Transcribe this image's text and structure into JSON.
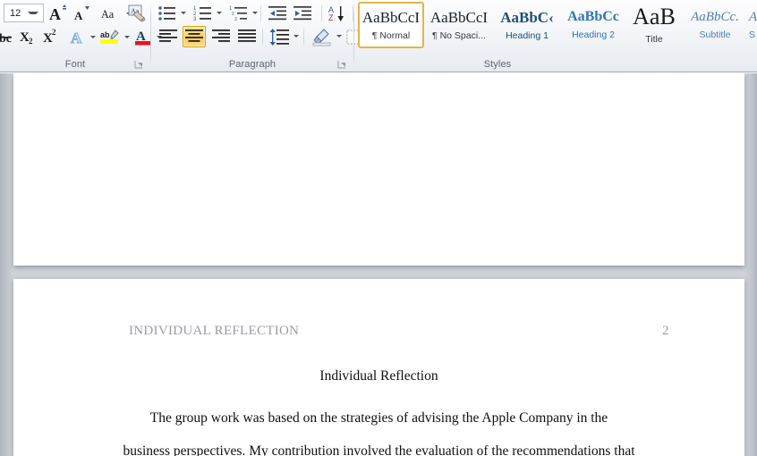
{
  "ribbon": {
    "groups": [
      {
        "id": "font",
        "label": "Font"
      },
      {
        "id": "paragraph",
        "label": "Paragraph"
      },
      {
        "id": "styles",
        "label": "Styles"
      }
    ],
    "font_group": {
      "font_size_value": "12",
      "buttons": [
        {
          "name": "font-size-box",
          "label": "12"
        },
        {
          "name": "grow-font-button",
          "label": "A"
        },
        {
          "name": "shrink-font-button",
          "label": "A"
        },
        {
          "name": "change-case-button",
          "label": "Aa"
        },
        {
          "name": "clear-formatting-button",
          "label": "Aa"
        },
        {
          "name": "strikethrough-button",
          "label": "abc"
        },
        {
          "name": "subscript-button",
          "label": "X2"
        },
        {
          "name": "superscript-button",
          "label": "X2"
        },
        {
          "name": "text-effects-button",
          "label": "A"
        },
        {
          "name": "text-highlight-color-button",
          "label": "ab"
        },
        {
          "name": "font-color-button",
          "label": "A"
        }
      ]
    },
    "paragraph_group": {
      "buttons": [
        {
          "name": "bullets-button",
          "label": "Bullets"
        },
        {
          "name": "numbering-button",
          "label": "Numbering"
        },
        {
          "name": "multilevel-list-button",
          "label": "Multilevel List"
        },
        {
          "name": "decrease-indent-button",
          "label": "Decrease Indent"
        },
        {
          "name": "increase-indent-button",
          "label": "Increase Indent"
        },
        {
          "name": "sort-button",
          "label": "Sort"
        },
        {
          "name": "show-formatting-marks-button",
          "label": "¶"
        },
        {
          "name": "align-left-button",
          "label": "Align Left"
        },
        {
          "name": "align-center-button",
          "label": "Center"
        },
        {
          "name": "align-right-button",
          "label": "Align Right"
        },
        {
          "name": "justify-button",
          "label": "Justify"
        },
        {
          "name": "line-spacing-button",
          "label": "Line and Paragraph Spacing"
        },
        {
          "name": "shading-button",
          "label": "Shading"
        },
        {
          "name": "borders-button",
          "label": "Borders"
        }
      ],
      "active_alignment": "center"
    },
    "styles_gallery": {
      "selected": "Normal",
      "items": [
        {
          "preview": "AaBbCcI",
          "name": "¶ Normal",
          "preview_style": "normal",
          "selected": true
        },
        {
          "preview": "AaBbCcI",
          "name": "¶ No Spaci...",
          "preview_style": "normal",
          "selected": false
        },
        {
          "preview": "AaBbC‹",
          "name": "Heading 1",
          "preview_style": "h1",
          "selected": false
        },
        {
          "preview": "AaBbCc",
          "name": "Heading 2",
          "preview_style": "h2",
          "selected": false
        },
        {
          "preview": "AaB",
          "name": "Title",
          "preview_style": "title",
          "selected": false
        },
        {
          "preview": "AaBbCc.",
          "name": "Subtitle",
          "preview_style": "subtitle",
          "selected": false
        },
        {
          "preview": "A",
          "name": "S",
          "preview_style": "subtle",
          "selected": false
        }
      ]
    }
  },
  "document": {
    "page1": {},
    "page2": {
      "header_text": "INDIVIDUAL REFLECTION",
      "page_number": "2",
      "title": "Individual Reflection",
      "paragraph_lines": [
        "The group work was based on the strategies of advising the Apple Company in the",
        "business perspectives.  My contribution involved the evaluation of the recommendations that"
      ]
    }
  },
  "colors": {
    "accent_gold": "#ffc74b",
    "ribbon_bg": "#f1f4f7",
    "canvas_gray": "#cdd2d7",
    "header_text_gray": "#9a9ca4",
    "style_blue": "#1f4e79"
  }
}
